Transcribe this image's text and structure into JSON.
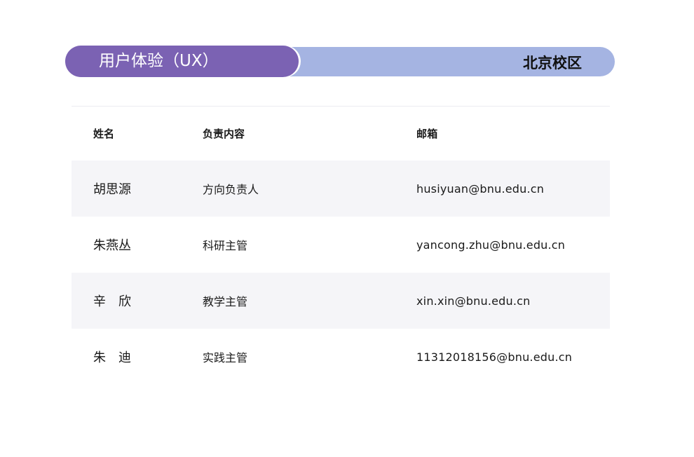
{
  "header": {
    "title": "用户体验（UX）",
    "campus": "北京校区",
    "colors": {
      "title_bg": "#7b62b3",
      "campus_bg": "#a5b4e2"
    }
  },
  "table": {
    "columns": [
      "姓名",
      "负责内容",
      "邮箱"
    ],
    "rows": [
      {
        "name": "胡思源",
        "role": "方向负责人",
        "email": "husiyuan@bnu.edu.cn"
      },
      {
        "name": "朱燕丛",
        "role": "科研主管",
        "email": "yancong.zhu@bnu.edu.cn"
      },
      {
        "name": "辛　欣",
        "role": "教学主管",
        "email": "xin.xin@bnu.edu.cn"
      },
      {
        "name": "朱　迪",
        "role": "实践主管",
        "email": "11312018156@bnu.edu.cn"
      }
    ]
  }
}
